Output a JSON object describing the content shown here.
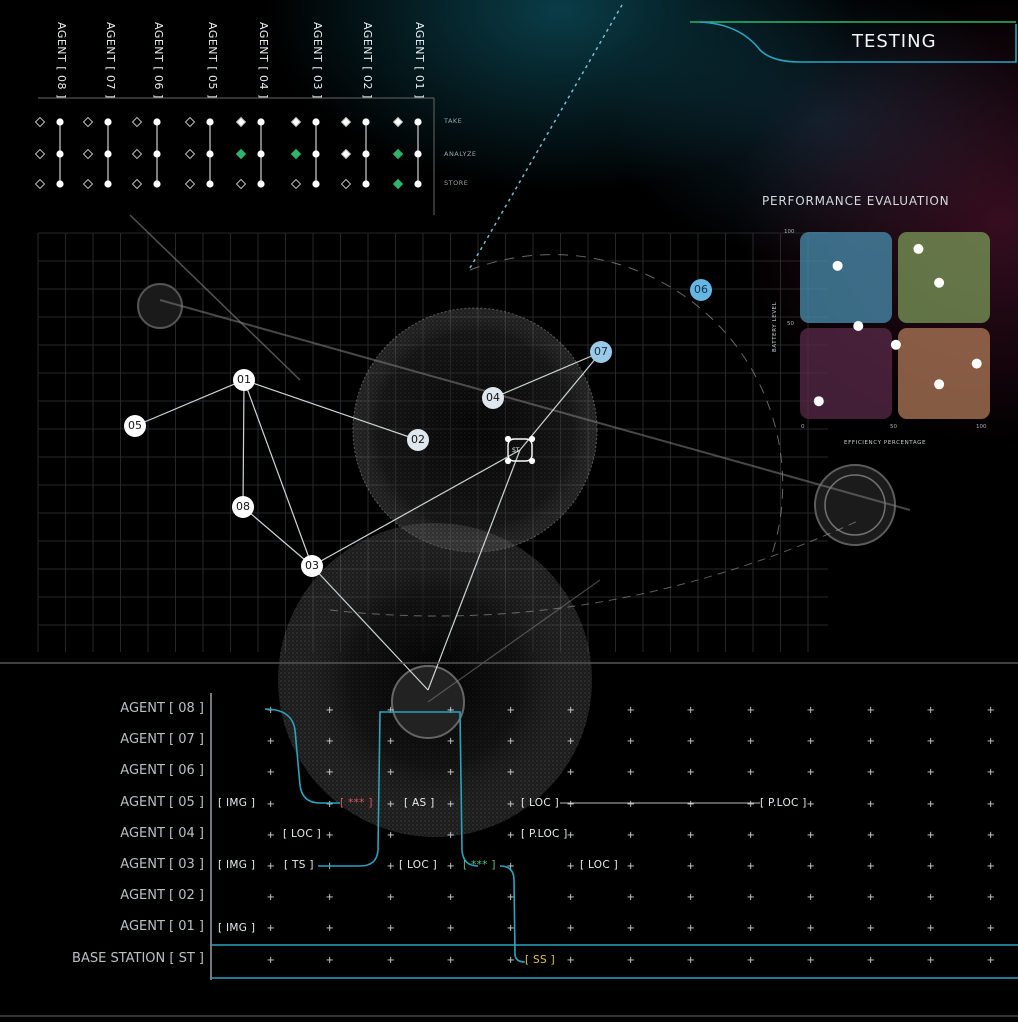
{
  "header": {
    "title": "TESTING"
  },
  "agent_columns": [
    {
      "label": "AGENT [ 08 ]"
    },
    {
      "label": "AGENT [ 07 ]"
    },
    {
      "label": "AGENT [ 06 ]"
    },
    {
      "label": "AGENT [ 05 ]"
    },
    {
      "label": "AGENT [ 04 ]"
    },
    {
      "label": "AGENT [ 03 ]"
    },
    {
      "label": "AGENT [ 02 ]"
    },
    {
      "label": "AGENT [ 01 ]"
    }
  ],
  "operations": [
    "TAKE",
    "ANALYZE",
    "STORE"
  ],
  "accent_colors": {
    "teal": "#2aa3c0",
    "green": "#2fb36a",
    "red": "#e0545a",
    "yellow": "#e6c448"
  },
  "map": {
    "nodes": [
      "01",
      "02",
      "03",
      "04",
      "05",
      "06",
      "07",
      "08"
    ],
    "station": "ST"
  },
  "performance": {
    "title": "PERFORMANCE EVALUATION",
    "ylabel": "BATTERY LEVEL",
    "xlabel": "EFFICIENCY PERCENTAGE",
    "yticks": [
      "100",
      "50"
    ],
    "xticks": [
      "0",
      "50",
      "100"
    ]
  },
  "chart_data": {
    "type": "scatter",
    "title": "PERFORMANCE EVALUATION",
    "xlabel": "EFFICIENCY PERCENTAGE",
    "ylabel": "BATTERY LEVEL",
    "xlim": [
      0,
      100
    ],
    "ylim": [
      0,
      100
    ],
    "grid": "four colored quadrants",
    "points": [
      {
        "x": 10,
        "y": 10
      },
      {
        "x": 20,
        "y": 82
      },
      {
        "x": 31,
        "y": 50
      },
      {
        "x": 51,
        "y": 40
      },
      {
        "x": 63,
        "y": 91
      },
      {
        "x": 74,
        "y": 73
      },
      {
        "x": 74,
        "y": 19
      },
      {
        "x": 94,
        "y": 30
      }
    ]
  },
  "timeline": {
    "rows": [
      {
        "label": "AGENT [ 08 ]"
      },
      {
        "label": "AGENT [ 07 ]"
      },
      {
        "label": "AGENT [ 06 ]"
      },
      {
        "label": "AGENT [ 05 ]"
      },
      {
        "label": "AGENT [ 04 ]"
      },
      {
        "label": "AGENT [ 03 ]"
      },
      {
        "label": "AGENT [ 02 ]"
      },
      {
        "label": "AGENT [ 01 ]"
      },
      {
        "label": "BASE STATION [ ST ]"
      }
    ],
    "tags": {
      "a05_img": "[ IMG ]",
      "a05_stars": "[ *** ]",
      "a05_as": "[ AS ]",
      "a05_loc": "[ LOC ]",
      "a05_ploc": "[ P.LOC ]",
      "a04_loc": "[ LOC ]",
      "a04_ploc": "[ P.LOC ]",
      "a03_img": "[ IMG ]",
      "a03_ts": "[ TS ]",
      "a03_loc1": "[ LOC ]",
      "a03_stars": "[ *** ]",
      "a03_loc2": "[ LOC ]",
      "a01_img": "[ IMG ]",
      "st_ss": "[ SS ]"
    }
  }
}
